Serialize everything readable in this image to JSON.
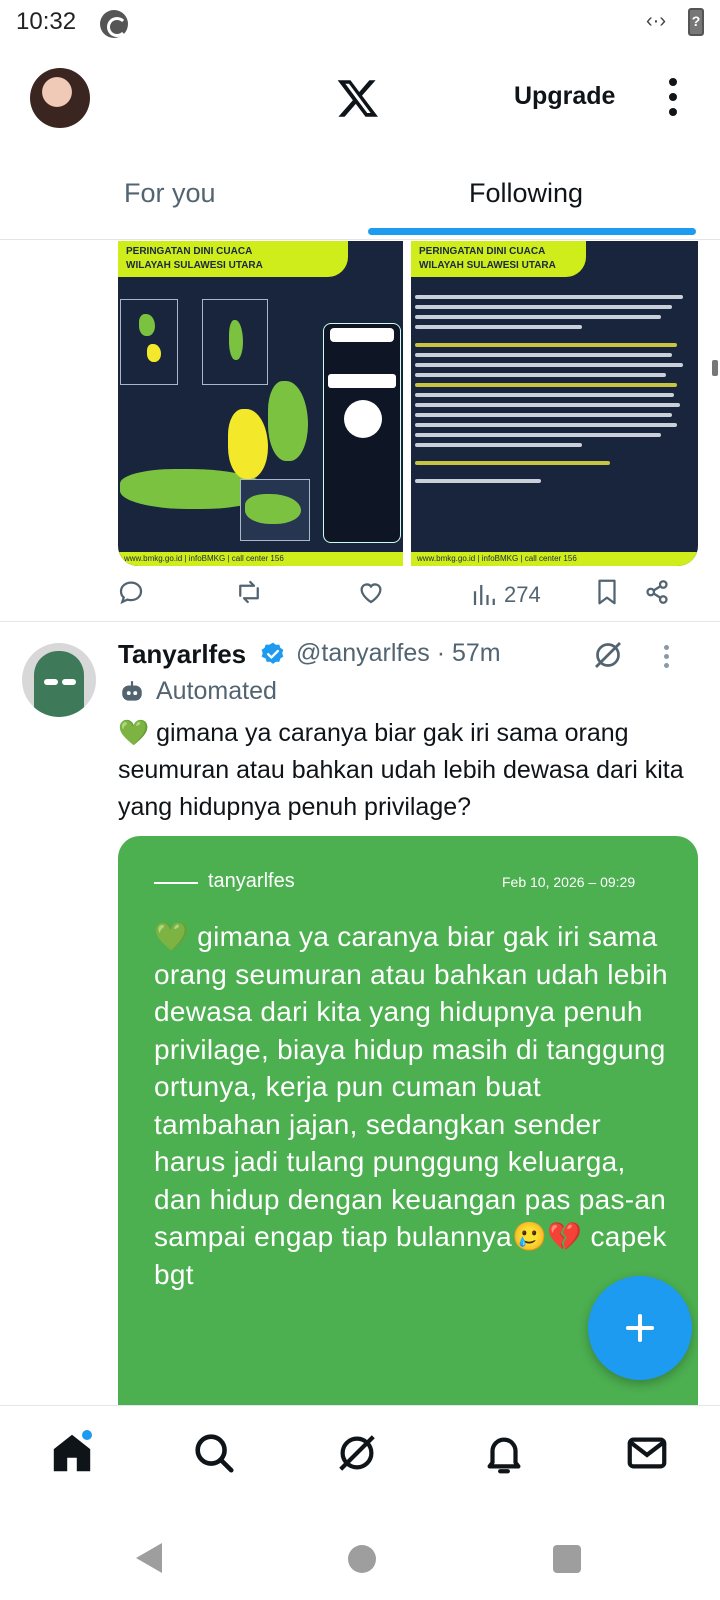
{
  "status_bar": {
    "time": "10:32",
    "code_icon": "code-icon",
    "battery": "?"
  },
  "top_bar": {
    "logo": "x-logo",
    "upgrade_label": "Upgrade",
    "more_icon": "more-vertical-icon"
  },
  "tabs": [
    {
      "label": "For you",
      "selected": false
    },
    {
      "label": "Following",
      "selected": true
    }
  ],
  "tweet1": {
    "images": [
      {
        "title": "PERINGATAN DINI CUACA\nWILAYAH SULAWESI UTARA",
        "footer": "www.bmkg.go.id   |   infoBMKG   |   call center 156"
      },
      {
        "title": "PERINGATAN DINI CUACA\nWILAYAH SULAWESI UTARA",
        "footer": "www.bmkg.go.id   |   infoBMKG   |   call center 156"
      }
    ],
    "actions": {
      "views": "274"
    }
  },
  "tweet2": {
    "name": "Tanyarlfes",
    "handle": "@tanyarlfes · 57m",
    "automated_label": "Automated",
    "heart_emoji": "💚",
    "text": " gimana ya caranya biar gak iri sama orang seumuran atau bahkan udah lebih dewasa dari kita yang hidupnya penuh privilage?",
    "card": {
      "author": "tanyarlfes",
      "timestamp": "Feb 10, 2026 – 09:29",
      "body": "💚 gimana ya caranya biar gak iri sama orang seumuran atau bahkan udah lebih dewasa dari kita yang hidupnya penuh privilage, biaya hidup masih di tanggung ortunya, kerja pun cuman buat tambahan jajan, sedangkan sender harus jadi tulang punggung keluarga, dan hidup dengan keuangan pas pas-an sampai engap tiap bulannya🥲💔 capek bgt"
    }
  },
  "colors": {
    "accent": "#1d9bf0",
    "card_green": "#4caf50",
    "muted": "#536471"
  }
}
